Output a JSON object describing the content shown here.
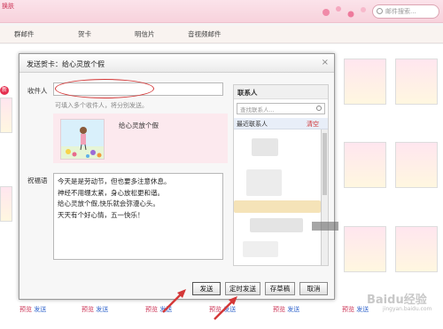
{
  "topbar": {
    "skin_link": "换肤",
    "search_placeholder": "邮件搜索..."
  },
  "nav_tabs": [
    "群邮件",
    "贺卡",
    "明信片",
    "音视频邮件"
  ],
  "bg_links": {
    "preview": "预览",
    "send": "发送"
  },
  "badge_new": "新",
  "dialog": {
    "title": "发送贺卡：给心灵放个假",
    "close": "×",
    "to_label": "收件人",
    "to_value": "",
    "to_hint": "可填入多个收件人，将分别发送。",
    "card_name": "给心灵放个假",
    "message_label": "祝福语",
    "message_lines": [
      "今天是是劳动节，但也要多注意休息。",
      "神经不用绷太紧，身心放松更和谐。",
      "给心灵放个假,快乐就会弥漫心头。",
      "天天有个好心情，五一快乐！"
    ],
    "buttons": {
      "send": "发送",
      "scheduled_send": "定时发送",
      "save_draft": "存草稿",
      "cancel": "取消"
    }
  },
  "contacts": {
    "title": "联系人",
    "search_placeholder": "查找联系人...",
    "recent_label": "最近联系人",
    "clear_label": "清空"
  },
  "watermark": {
    "text": "Baidu经验",
    "url": "jingyan.baidu.com"
  },
  "colors": {
    "annotation_red": "#d43838",
    "accent_pink": "#cc3355",
    "link_blue": "#3366cc"
  }
}
